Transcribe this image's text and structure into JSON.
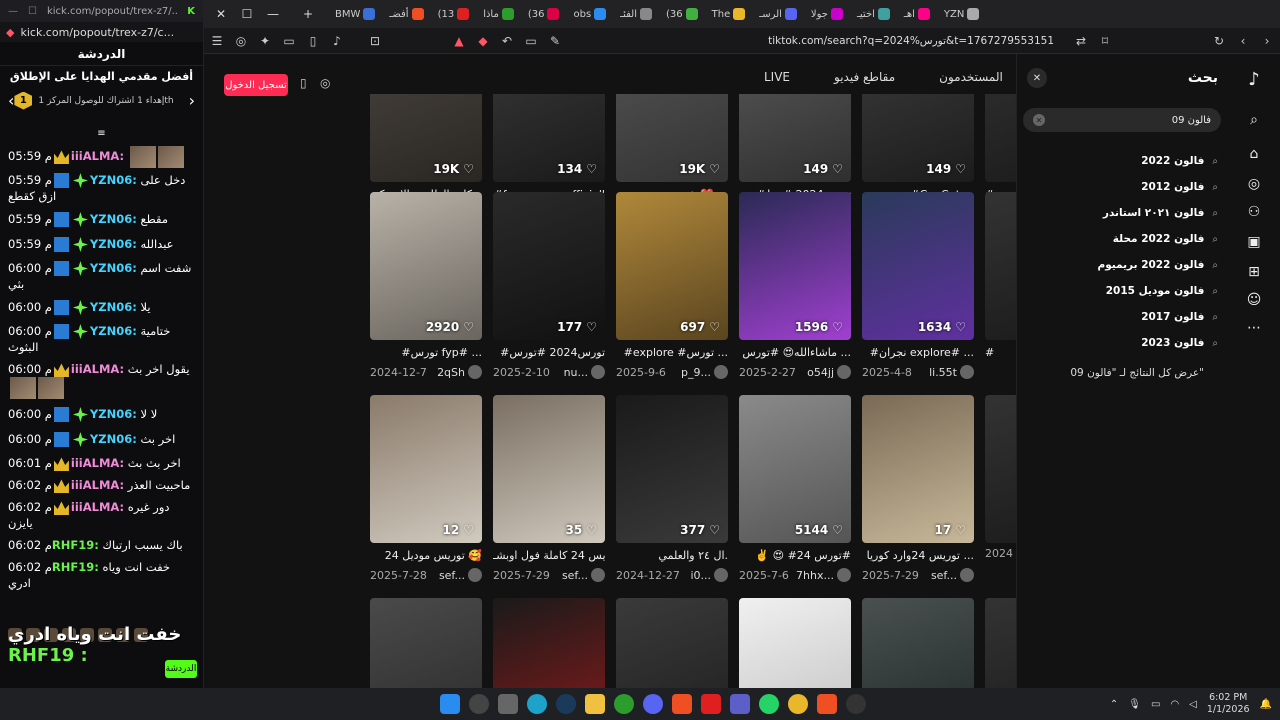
{
  "kick": {
    "url": "kick.com/popout/trex-z7/c...",
    "url_top": "kick.com/popout/trex-z7/...",
    "chat_title": "الدردشة",
    "gift_title": "أفضل مقدمي الهدايا على الإطلاق",
    "gift_text": "إهداء 1 اشتراك للوصول المركز 1th",
    "gift_rank": "1",
    "messages": [
      {
        "time": "05:59 م",
        "user": "iiiALMA:",
        "color": "p",
        "text": "",
        "badge": "crown",
        "thumbs": true
      },
      {
        "time": "05:59 م",
        "user": "YZN06:",
        "color": "g",
        "text": "دخل على ازق كقطع",
        "badge": "swd"
      },
      {
        "time": "05:59 م",
        "user": "YZN06:",
        "color": "g",
        "text": "مقطع",
        "badge": "swd"
      },
      {
        "time": "05:59 م",
        "user": "YZN06:",
        "color": "g",
        "text": "عبدالله",
        "badge": "swd"
      },
      {
        "time": "06:00 م",
        "user": "YZN06:",
        "color": "g",
        "text": "شفت اسم بثي",
        "badge": "swd"
      },
      {
        "time": "06:00 م",
        "user": "YZN06:",
        "color": "g",
        "text": "يلا",
        "badge": "swd"
      },
      {
        "time": "06:00 م",
        "user": "YZN06:",
        "color": "g",
        "text": "ختامية البثوث",
        "badge": "swd"
      },
      {
        "time": "06:00 م",
        "user": "iiiALMA:",
        "color": "p",
        "text": "يقول اخر بث",
        "badge": "crown",
        "thumbs": true
      },
      {
        "time": "06:00 م",
        "user": "YZN06:",
        "color": "g",
        "text": "لا لا",
        "badge": "swd"
      },
      {
        "time": "06:00 م",
        "user": "YZN06:",
        "color": "g",
        "text": "اخر بث",
        "badge": "swd"
      },
      {
        "time": "06:01 م",
        "user": "iiiALMA:",
        "color": "p",
        "text": "اخر بث بث",
        "badge": "crown"
      },
      {
        "time": "06:02 م",
        "user": "iiiALMA:",
        "color": "p",
        "text": "ماحبيت العذر",
        "badge": "crown"
      },
      {
        "time": "06:02 م",
        "user": "iiiALMA:",
        "color": "p",
        "text": "دور غيره يايزن",
        "badge": "crown"
      },
      {
        "time": "06:02 م",
        "user": "RHF19:",
        "color": "lg",
        "text": "باك يسبب ارتباك",
        "badge": ""
      },
      {
        "time": "06:02 م",
        "user": "RHF19:",
        "color": "lg",
        "text": "خفت انت وياه ادري",
        "badge": ""
      }
    ],
    "overlay_user": "RHF19 :",
    "overlay_text": "خفت انت وياه ادري",
    "send_label": "الدردشة"
  },
  "browser": {
    "tabs": [
      "BMW",
      "أفضـ",
      "(13",
      "ماذا",
      "(36",
      "obs",
      "الفئـ",
      "(36",
      "The",
      "الرسـ",
      "جولا",
      "اختيـ",
      "اهـ",
      "YZN"
    ],
    "url": "tiktok.com/search?q=2024%تورس&t=1767279553151"
  },
  "tiktok": {
    "login_label": "تسجيل الدخول",
    "tabs": [
      {
        "label": "LIVE",
        "active": false
      },
      {
        "label": "مقاطع فيديو",
        "active": false
      },
      {
        "label": "المستخدمون",
        "active": false
      }
    ],
    "search_title": "بحث",
    "search_query": "فالون 09",
    "suggestions": [
      "فالون 2022",
      "فالون 2012",
      "فالون ٢٠٢١ استاندر",
      "فالون 2022 محلة",
      "فالون 2022 بريميوم",
      "فالون موديل 2015",
      "فالون 2017",
      "فالون 2023"
    ],
    "see_all": "عرض كل النتائج لـ \"فالون 09\"",
    "cards": [
      {
        "row": 0,
        "col": 0,
        "likes": "19K",
        "desc": "ركاب الظاهره الامريكيه ...",
        "date": "2024-4-27",
        "user": "rvfe",
        "c1": "#4a4540",
        "c2": "#2a2622"
      },
      {
        "row": 0,
        "col": 1,
        "likes": "134",
        "desc": "#foryoupageofficiall",
        "date": "2025-4-23",
        "user": "i0z...",
        "c1": "#3a3a3a",
        "c2": "#1a1a1a"
      },
      {
        "row": 0,
        "col": 2,
        "likes": "19K",
        "desc": "شف جديدي ❤️ ...",
        "date": "2024-5-31",
        "user": "c68.i",
        "c1": "#555",
        "c2": "#333"
      },
      {
        "row": 0,
        "col": 3,
        "likes": "149",
        "desc": "#تورس2024 #خط",
        "date": "2025-6-23",
        "user": "c5...",
        "c1": "#5a5a5a",
        "c2": "#2f2f2f"
      },
      {
        "row": 0,
        "col": 4,
        "likes": "149",
        "desc": "#CapCut ...",
        "date": "2025-7-26",
        "user": "707...",
        "c1": "#3c3c3c",
        "c2": "#1c1c1c"
      },
      {
        "row": 1,
        "col": 0,
        "likes": "2920",
        "desc": "#تورس fyp# ...",
        "date": "2024-12-7",
        "user": "2qSh",
        "c1": "#b8b2a8",
        "c2": "#6a655e"
      },
      {
        "row": 1,
        "col": 1,
        "likes": "177",
        "desc": "#تورس2024 #تورس",
        "date": "2025-2-10",
        "user": "nu...",
        "c1": "#2a2a2a",
        "c2": "#111"
      },
      {
        "row": 1,
        "col": 2,
        "likes": "697",
        "desc": "#explore #تورس ...",
        "date": "2025-9-6",
        "user": "p_9...",
        "c1": "#b0883a",
        "c2": "#5a4520"
      },
      {
        "row": 1,
        "col": 3,
        "likes": "1596",
        "desc": "ماشاءالله😍 #تورس ...",
        "date": "2025-2-27",
        "user": "o54jj",
        "c1": "#2a2a55",
        "c2": "#a040d0"
      },
      {
        "row": 1,
        "col": 4,
        "likes": "1634",
        "desc": "#نجران explore# ...",
        "date": "2025-4-8",
        "user": "li.55t",
        "c1": "#2a3a5a",
        "c2": "#6030a0"
      },
      {
        "row": 2,
        "col": 0,
        "likes": "12",
        "desc": "توريس موديل 24 🥰",
        "date": "2025-7-28",
        "user": "sef...",
        "c1": "#8a7a6a",
        "c2": "#d0cabf"
      },
      {
        "row": 2,
        "col": 1,
        "likes": "35",
        "desc": "توريس 24 كاملة فول اوبشـ...",
        "date": "2025-7-29",
        "user": "sef...",
        "c1": "#7a6e62",
        "c2": "#cfc8bc"
      },
      {
        "row": 2,
        "col": 2,
        "likes": "377",
        "desc": "ال ٢٤ والعلمي.",
        "date": "2024-12-27",
        "user": "i0...",
        "c1": "#1a1a1a",
        "c2": "#3a3a3a"
      },
      {
        "row": 2,
        "col": 3,
        "likes": "5144",
        "desc": "✌️ 😍 #تورس 24#",
        "date": "2025-7-6",
        "user": "7hhx...",
        "c1": "#8a8a8a",
        "c2": "#555"
      },
      {
        "row": 2,
        "col": 4,
        "likes": "17",
        "desc": "توريس 24وارد كوريا ...",
        "date": "2025-7-29",
        "user": "sef...",
        "c1": "#7a6a55",
        "c2": "#c8b89a"
      },
      {
        "row": 3,
        "col": 0,
        "likes": "",
        "desc": "",
        "date": "",
        "user": "",
        "c1": "#4a4a4a",
        "c2": "#2a2a2a"
      },
      {
        "row": 3,
        "col": 1,
        "likes": "",
        "desc": "",
        "date": "",
        "user": "",
        "c1": "#1a1a1a",
        "c2": "#8a1a1a"
      },
      {
        "row": 3,
        "col": 2,
        "likes": "",
        "desc": "",
        "date": "",
        "user": "",
        "c1": "#3a3a3a",
        "c2": "#1e1e1e"
      },
      {
        "row": 3,
        "col": 3,
        "likes": "",
        "desc": "",
        "date": "",
        "user": "",
        "c1": "#f0f0f0",
        "c2": "#c0c0c0"
      },
      {
        "row": 3,
        "col": 4,
        "likes": "",
        "desc": "",
        "date": "",
        "user": "",
        "c1": "#4a5050",
        "c2": "#202828"
      }
    ],
    "partial_col": {
      "desc_row0": "# ...",
      "date_row0": "2025",
      "desc_row1": "#",
      "date_row2": "2024"
    }
  },
  "taskbar": {
    "time": "6:02 PM",
    "date": "1/1/2026"
  }
}
